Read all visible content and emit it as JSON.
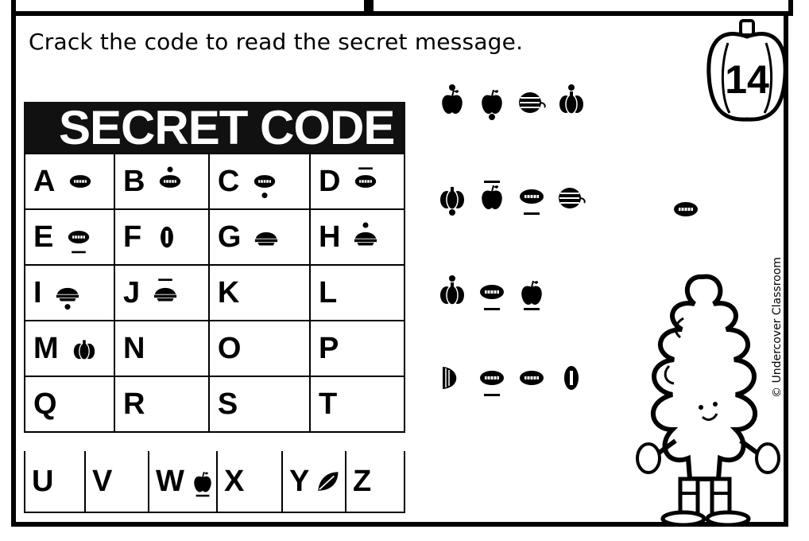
{
  "instruction": "Crack the code to read the secret message.",
  "page_number": "14",
  "code_title": "SECRET CODE",
  "copyright": "© Undercover Classroom",
  "code_table": {
    "rows": [
      [
        {
          "letter": "A",
          "icon": "football-icon"
        },
        {
          "letter": "B",
          "icon": "football-dot-above-icon"
        },
        {
          "letter": "C",
          "icon": "football-dot-below-icon"
        },
        {
          "letter": "D",
          "icon": "football-line-above-icon"
        }
      ],
      [
        {
          "letter": "E",
          "icon": "football-line-below-icon"
        },
        {
          "letter": "F",
          "icon": "football-vertical-icon"
        },
        {
          "letter": "G",
          "icon": "pie-icon"
        },
        {
          "letter": "H",
          "icon": "pie-dot-above-icon"
        }
      ],
      [
        {
          "letter": "I",
          "icon": "pie-dot-below-icon"
        },
        {
          "letter": "J",
          "icon": "pie-line-above-icon"
        },
        {
          "letter": "K",
          "icon": ""
        },
        {
          "letter": "L",
          "icon": ""
        }
      ],
      [
        {
          "letter": "M",
          "icon": "pumpkin-icon"
        },
        {
          "letter": "N",
          "icon": ""
        },
        {
          "letter": "O",
          "icon": ""
        },
        {
          "letter": "P",
          "icon": ""
        }
      ],
      [
        {
          "letter": "Q",
          "icon": ""
        },
        {
          "letter": "R",
          "icon": ""
        },
        {
          "letter": "S",
          "icon": ""
        },
        {
          "letter": "T",
          "icon": ""
        }
      ]
    ],
    "last_row": [
      {
        "letter": "U",
        "icon": ""
      },
      {
        "letter": "V",
        "icon": ""
      },
      {
        "letter": "W",
        "icon": "apple-line-below-icon"
      },
      {
        "letter": "X",
        "icon": ""
      },
      {
        "letter": "Y",
        "icon": "leaf-icon"
      },
      {
        "letter": "Z",
        "icon": ""
      }
    ]
  },
  "message_lines": [
    [
      "apple-dot-above-icon",
      "apple-dot-below-icon",
      "gourd-icon",
      "pumpkin-dot-above-icon"
    ],
    [
      "pumpkin-dot-below-icon",
      "apple-line-above-icon",
      "football-line-below-icon",
      "gourd-icon"
    ],
    [
      "pumpkin-dot-above-icon",
      "football-line-below-icon",
      "apple-line-below-icon"
    ],
    [
      "pie-slice-icon",
      "football-line-below-icon",
      "football-icon",
      "football-vertical-icon"
    ]
  ],
  "extra_word": [
    "football-icon"
  ]
}
